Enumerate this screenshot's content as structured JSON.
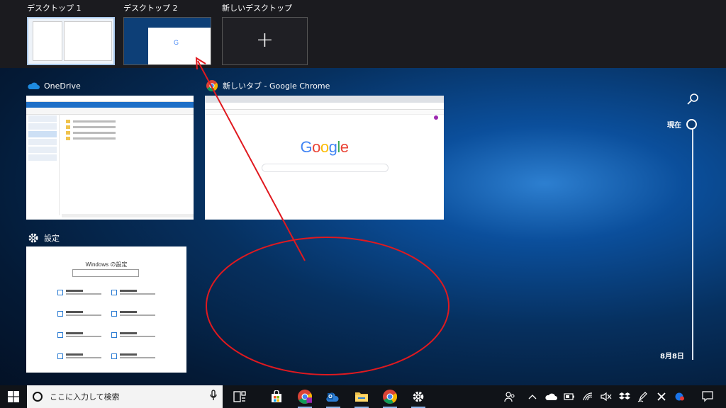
{
  "desktops": [
    {
      "label": "デスクトップ 1"
    },
    {
      "label": "デスクトップ 2"
    },
    {
      "label": "新しいデスクトップ",
      "icon": "plus-icon"
    }
  ],
  "windows": {
    "onedrive": {
      "title": "OneDrive"
    },
    "chrome": {
      "title": "新しいタブ - Google Chrome",
      "logo": {
        "G": "G",
        "o1": "o",
        "o2": "o",
        "g": "g",
        "l": "l",
        "e": "e"
      },
      "logo_colors": [
        "#4285f4",
        "#ea4335",
        "#fbbc05",
        "#4285f4",
        "#34a853",
        "#ea4335"
      ]
    },
    "settings": {
      "title": "設定",
      "window_heading": "Windows の設定"
    }
  },
  "timeline": {
    "now_label": "現在",
    "date_label": "8月8日"
  },
  "taskbar": {
    "search_placeholder": "ここに入力して検索",
    "apps": [
      "task-view-icon",
      "store-icon",
      "chrome-icon",
      "outlook-icon",
      "file-explorer-icon",
      "chrome-icon",
      "settings-icon"
    ],
    "tray": [
      "people-icon",
      "chevron-up-icon",
      "onedrive-icon",
      "battery-icon",
      "wifi-icon",
      "volume-mute-icon",
      "dropbox-icon",
      "pen-icon",
      "close-icon",
      "app-icon",
      "notification-icon"
    ]
  },
  "colors": {
    "accent": "#1e6fc7",
    "annotation": "#e0191f"
  }
}
